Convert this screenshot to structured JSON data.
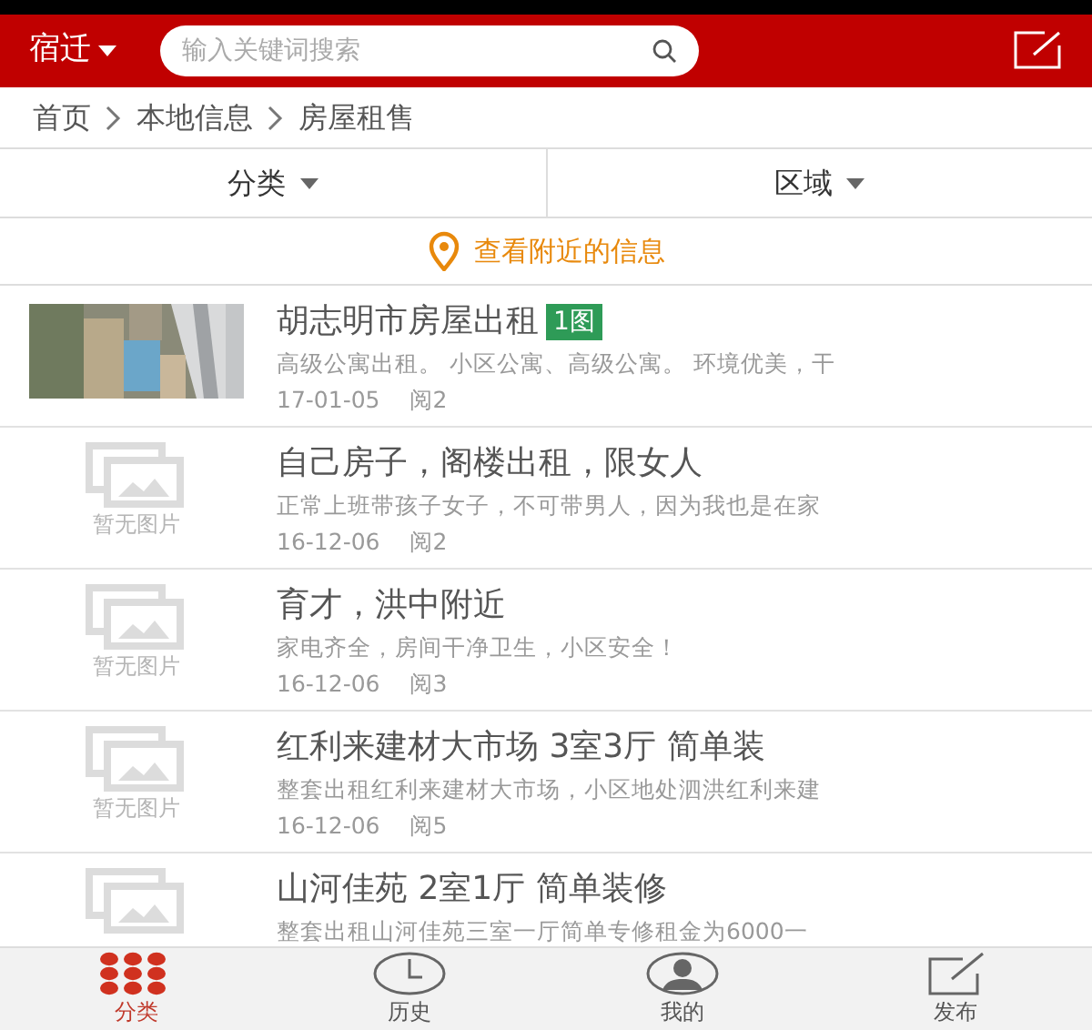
{
  "header": {
    "city": "宿迁",
    "search_placeholder": "输入关键词搜索"
  },
  "breadcrumb": [
    "首页",
    "本地信息",
    "房屋租售"
  ],
  "filters": [
    {
      "label": "分类"
    },
    {
      "label": "区域"
    }
  ],
  "nearby": {
    "label": "查看附近的信息"
  },
  "listings": [
    {
      "kind": "picture",
      "title": "胡志明市房屋出租",
      "badge": "1图",
      "summary": "高级公寓出租。 小区公寓、高级公寓。 环境优美，干",
      "date": "17-01-05",
      "views": "阅2"
    },
    {
      "kind": "none",
      "no_image_label": "暂无图片",
      "title": "自己房子，阁楼出租，限女人",
      "summary": "正常上班带孩子女子，不可带男人，因为我也是在家",
      "date": "16-12-06",
      "views": "阅2"
    },
    {
      "kind": "none",
      "no_image_label": "暂无图片",
      "title": "育才，洪中附近",
      "summary": "家电齐全，房间干净卫生，小区安全！",
      "date": "16-12-06",
      "views": "阅3"
    },
    {
      "kind": "none",
      "no_image_label": "暂无图片",
      "title": "红利来建材大市场 3室3厅 简单装",
      "summary": "整套出租红利来建材大市场，小区地处泗洪红利来建",
      "date": "16-12-06",
      "views": "阅5"
    },
    {
      "kind": "none",
      "title": "山河佳苑 2室1厅 简单装修",
      "summary": "整套出租山河佳苑三室一厅简单专修租金为6000一"
    }
  ],
  "tabbar": [
    {
      "kind": "grid",
      "label": "分类",
      "selected": true
    },
    {
      "kind": "clock",
      "label": "历史",
      "selected": false
    },
    {
      "kind": "person",
      "label": "我的",
      "selected": false
    },
    {
      "kind": "compose",
      "label": "发布",
      "selected": false
    }
  ]
}
